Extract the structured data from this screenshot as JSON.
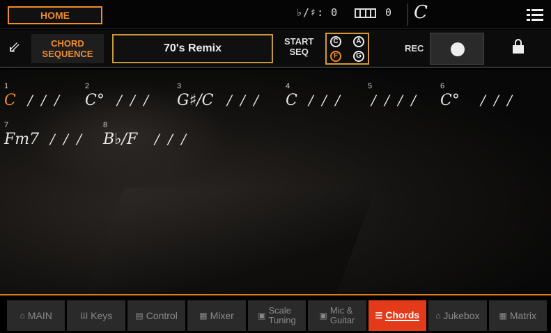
{
  "topbar": {
    "home_label": "HOME",
    "transpose": "♭/♯: 0",
    "octave": "0",
    "key": "C"
  },
  "seq": {
    "chord_seq_line1": "CHORD",
    "chord_seq_line2": "SEQUENCE",
    "name": "70's Remix",
    "start_line1": "START",
    "start_line2": "SEQ",
    "icon_letters": [
      "C",
      "A",
      "F",
      "G"
    ],
    "rec_label": "REC"
  },
  "chords": [
    {
      "num": "1",
      "chord": "C",
      "slashes": "/ / /",
      "selected": true
    },
    {
      "num": "2",
      "chord": "C°",
      "slashes": "/ / /"
    },
    {
      "num": "3",
      "chord": "G♯/C",
      "slashes": "/ / /"
    },
    {
      "num": "4",
      "chord": "C",
      "slashes": "/ / /"
    },
    {
      "num": "5",
      "chord": "",
      "slashes": "/ / / /"
    },
    {
      "num": "6",
      "chord": "C°",
      "slashes": "/ / /"
    },
    {
      "num": "7",
      "chord": "Fm7",
      "slashes": "/ / /"
    },
    {
      "num": "8",
      "chord": "B♭/F",
      "slashes": "/ / /"
    }
  ],
  "tabs": [
    {
      "icon": "home-icon",
      "glyph": "⌂",
      "label": "MAIN"
    },
    {
      "icon": "keys-icon",
      "glyph": "Ш",
      "label": "Keys"
    },
    {
      "icon": "control-icon",
      "glyph": "▤",
      "label": "Control"
    },
    {
      "icon": "mixer-icon",
      "glyph": "▦",
      "label": "Mixer"
    },
    {
      "icon": "scale-icon",
      "glyph": "▣",
      "label": "Scale",
      "label2": "Tuning"
    },
    {
      "icon": "mic-icon",
      "glyph": "▣",
      "label": "Mic &",
      "label2": "Guitar"
    },
    {
      "icon": "chords-icon",
      "glyph": "☰",
      "label": "Chords",
      "active": true
    },
    {
      "icon": "jukebox-icon",
      "glyph": "⌂",
      "label": "Jukebox"
    },
    {
      "icon": "matrix-icon",
      "glyph": "▦",
      "label": "Matrix"
    }
  ],
  "colors": {
    "accent": "#f08c2b",
    "active_tab": "#e33a1a"
  }
}
